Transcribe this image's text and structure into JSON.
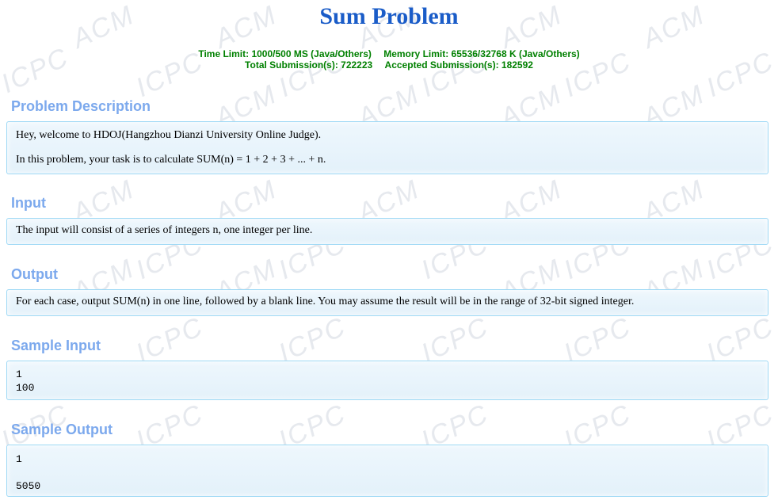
{
  "page": {
    "title": "Sum Problem",
    "limits_line": [
      "Time Limit: 1000/500 MS (Java/Others)",
      "Memory Limit: 65536/32768 K (Java/Others)"
    ],
    "submissions_line": [
      "Total Submission(s): 722223",
      "Accepted Submission(s): 182592"
    ]
  },
  "watermark": {
    "words": [
      "ACM",
      "ICPC"
    ],
    "color": "#e6e9ee"
  },
  "colors": {
    "title": "#1a5cc8",
    "meta": "#008000",
    "heading": "#7ca9ed",
    "box_border": "#9fd9f5",
    "box_bg": "#e9f4fb"
  },
  "sections": {
    "description": {
      "heading": "Problem Description",
      "paragraphs": [
        "Hey, welcome to HDOJ(Hangzhou Dianzi University Online Judge).",
        "In this problem, your task is to calculate SUM(n) = 1 + 2 + 3 + ... + n."
      ]
    },
    "input": {
      "heading": "Input",
      "text": "The input will consist of a series of integers n, one integer per line."
    },
    "output": {
      "heading": "Output",
      "text": "For each case, output SUM(n) in one line, followed by a blank line. You may assume the result will be in the range of 32-bit signed integer."
    },
    "sample_input": {
      "heading": "Sample Input",
      "text": "1\n100"
    },
    "sample_output": {
      "heading": "Sample Output",
      "text": "1\n\n5050"
    }
  }
}
